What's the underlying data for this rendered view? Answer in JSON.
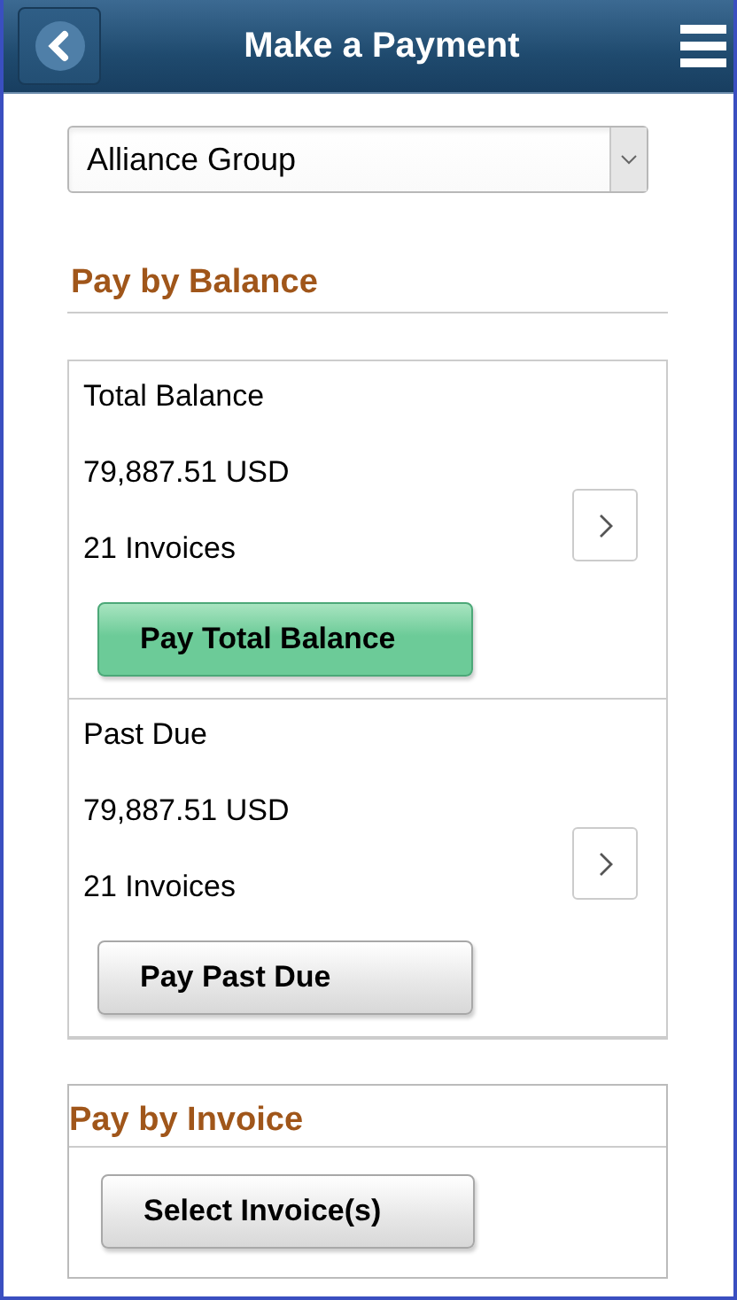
{
  "header": {
    "title": "Make a Payment"
  },
  "customer_select": {
    "value": "Alliance Group"
  },
  "pay_by_balance": {
    "heading": "Pay by Balance",
    "rows": [
      {
        "label": "Total Balance",
        "amount": "79,887.51 USD",
        "invoices": "21 Invoices",
        "button": {
          "label": "Pay Total Balance",
          "kind": "primary"
        }
      },
      {
        "label": "Past Due",
        "amount": "79,887.51 USD",
        "invoices": "21 Invoices",
        "button": {
          "label": "Pay Past Due",
          "kind": "default"
        }
      }
    ]
  },
  "pay_by_invoice": {
    "heading": "Pay by Invoice",
    "button": {
      "label": "Select Invoice(s)",
      "kind": "default"
    }
  }
}
